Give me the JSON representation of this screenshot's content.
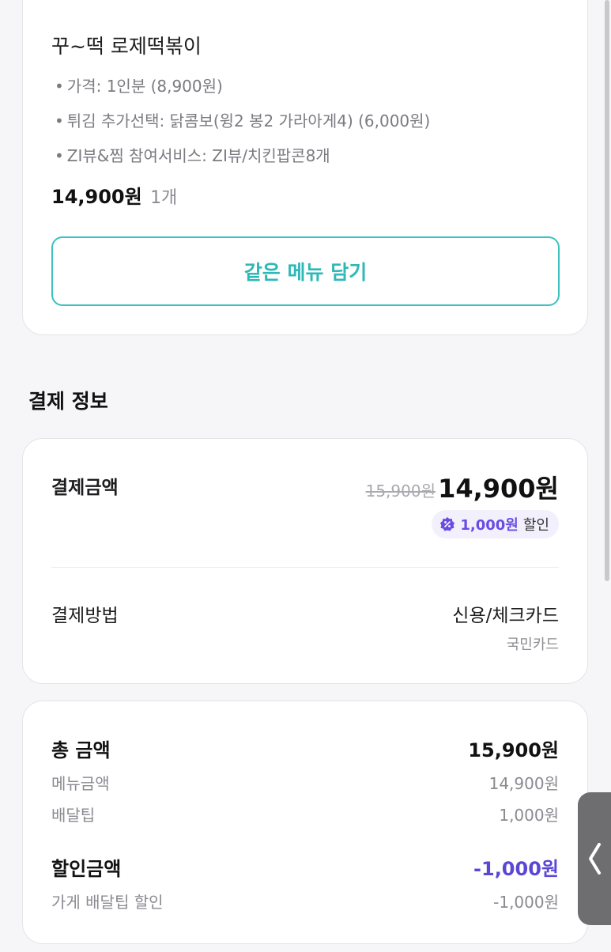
{
  "menu": {
    "name": "꾸~떡 로제떡볶이",
    "options": [
      "가격: 1인분 (8,900원)",
      "튀김 추가선택: 닭콤보(윙2 봉2 가라아게4) (6,000원)",
      "ZI뷰&찜 참여서비스: ZI뷰/치킨팝콘8개"
    ],
    "bullet": "•",
    "price": "14,900원",
    "quantity": "1개",
    "same_menu_button": "같은 메뉴 담기"
  },
  "payment_info": {
    "section_title": "결제 정보",
    "amount_label": "결제금액",
    "original_price": "15,900원",
    "final_price": "14,900원",
    "discount_amount": "1,000원",
    "discount_suffix": "할인",
    "method_label": "결제방법",
    "method_value": "신용/체크카드",
    "card_name": "국민카드"
  },
  "summary": {
    "total_label": "총 금액",
    "total_value": "15,900원",
    "menu_amount_label": "메뉴금액",
    "menu_amount_value": "14,900원",
    "delivery_tip_label": "배달팁",
    "delivery_tip_value": "1,000원",
    "discount_label": "할인금액",
    "discount_value": "-1,000원",
    "store_tip_discount_label": "가게 배달팁 할인",
    "store_tip_discount_value": "-1,000원"
  },
  "side_tab": {
    "icon": "chevron-left-icon"
  },
  "colors": {
    "teal": "#2fb8b6",
    "purple": "#5b47d6"
  }
}
